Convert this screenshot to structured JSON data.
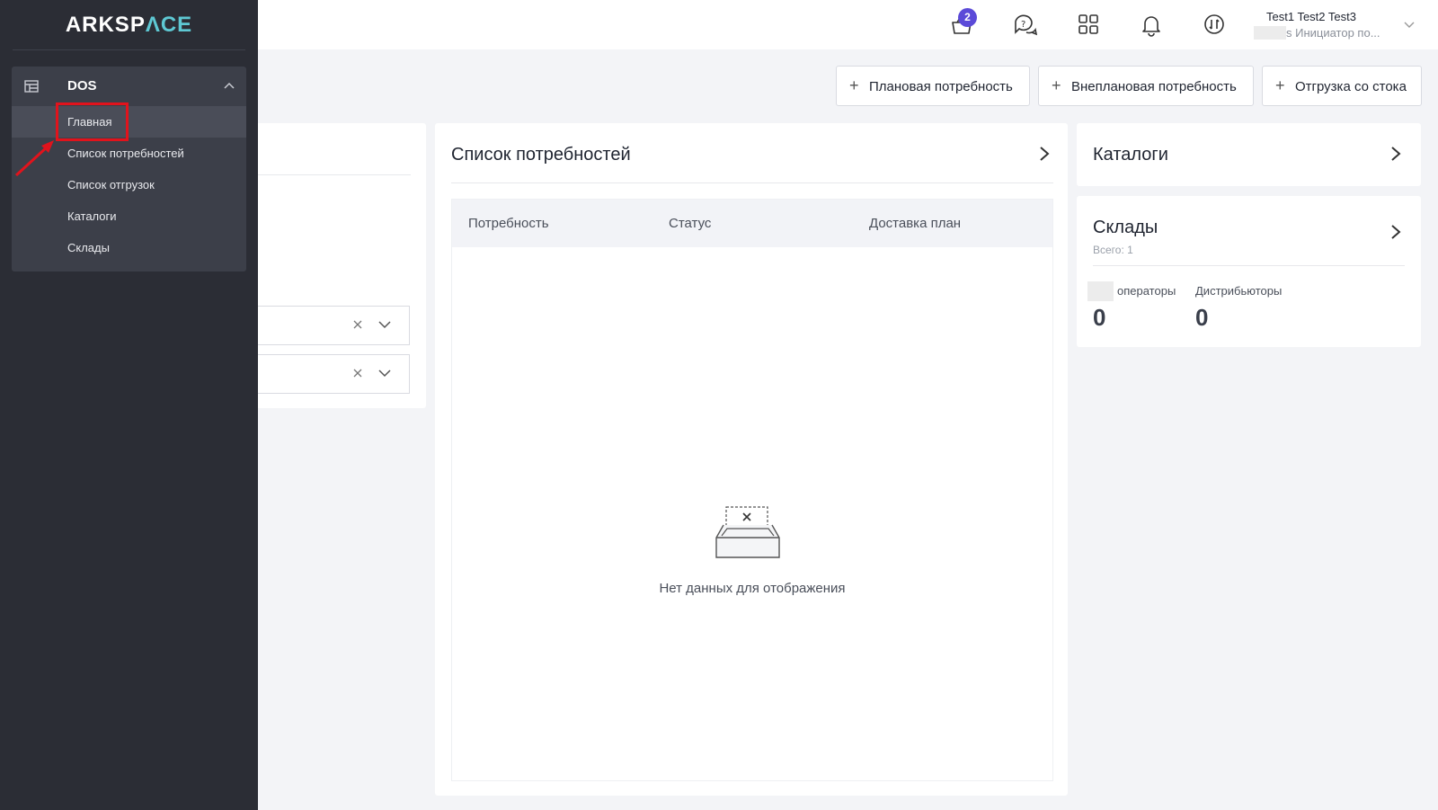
{
  "brand": {
    "logo_main": "ARKSP",
    "logo_accent": "ΛCE"
  },
  "sidebar": {
    "group_title": "DOS",
    "items": [
      {
        "label": "Главная",
        "active": true
      },
      {
        "label": "Список потребностей"
      },
      {
        "label": "Список отгрузок"
      },
      {
        "label": "Каталоги"
      },
      {
        "label": "Склады"
      }
    ]
  },
  "header": {
    "cart_badge": "2",
    "icons": [
      "cart-icon",
      "chat-help-icon",
      "apps-grid-icon",
      "bell-icon",
      "sync-icon"
    ],
    "user_name": "Test1 Test2 Test3",
    "user_role": "s Инициатор по..."
  },
  "actions": {
    "planned": "Плановая потребность",
    "unplanned": "Внеплановая потребность",
    "stock_shipment": "Отгрузка со стока"
  },
  "needs_panel": {
    "title": "Список потребностей",
    "columns": [
      "Потребность",
      "Статус",
      "Доставка план"
    ],
    "empty_text": "Нет данных для отображения"
  },
  "catalogs_panel": {
    "title": "Каталоги"
  },
  "warehouses_panel": {
    "title": "Склады",
    "subtitle": "Всего: 1",
    "stats": [
      {
        "label": "операторы",
        "value": "0"
      },
      {
        "label": "Дистрибьюторы",
        "value": "0"
      }
    ]
  },
  "colors": {
    "sidebar_bg": "#2b2d35",
    "accent": "#5ec8d3",
    "badge": "#5b4ad8",
    "highlight": "#e1131c"
  }
}
